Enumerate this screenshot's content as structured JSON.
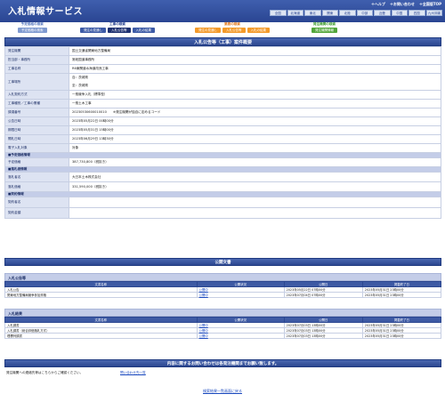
{
  "header": {
    "title": "入札情報サービス",
    "links": [
      "＋ヘルプ",
      "＋お問い合わせ",
      "＋全国版TOP"
    ],
    "regions": [
      "全国",
      "北海道",
      "東北",
      "関東",
      "北陸",
      "中部",
      "近畿",
      "中国",
      "四国",
      "九州沖縄"
    ]
  },
  "nav": {
    "groups": [
      {
        "caption": "予定価格の検索",
        "tabs": [
          "予定価格の検索"
        ]
      },
      {
        "caption": "工事の検索",
        "tabs": [
          "発注の見通し",
          "入札公告等",
          "入札の結果"
        ],
        "active": "入札公告等"
      },
      {
        "caption": "業務の検索",
        "tabs": [
          "発注の見通し",
          "入札公告等",
          "入札の結果"
        ]
      },
      {
        "caption": "発注機関の検索",
        "tabs": [
          "発注機関情報"
        ]
      }
    ]
  },
  "main": {
    "title": "入札公告等（工事）案件概要",
    "rows": [
      {
        "k": "発注機関",
        "v": "国土交通省関東地方整備局",
        "h": 10
      },
      {
        "k": "担当部・事務所",
        "v": "常総国道事務所",
        "h": 9
      },
      {
        "k": "工事名称",
        "v": "R6東関道水海道改良工事",
        "h": 9
      },
      {
        "k": "工事場所",
        "v": "自：茨城県\n至：茨城県",
        "h": 18
      },
      {
        "k": "入札契約方式",
        "v": "一般競争入札（標準型）",
        "h": 9
      },
      {
        "k": "工事種別／工事の業種",
        "v": "一般土木工事",
        "h": 9
      },
      {
        "k": "調達番号",
        "v": "20230530600010010　　※発注機関が独自に定めるコード",
        "h": 9
      },
      {
        "k": "公告日時",
        "v": "2023年05月22日 00時00分",
        "h": 9
      },
      {
        "k": "期限日時",
        "v": "2023年05月31日 15時00分",
        "h": 9
      },
      {
        "k": "開札日時",
        "v": "2023年06月29日 13時30分",
        "h": 9
      },
      {
        "k": "電子入札対象",
        "v": "対象",
        "h": 9
      },
      {
        "sec": "■予定価格情報",
        "h": 6
      },
      {
        "k": "予定価格",
        "v": "387,730,800（税抜き）",
        "h": 10
      },
      {
        "sec": "■落札者情報",
        "h": 6
      },
      {
        "k": "落札者名",
        "v": "大日本土木株式会社",
        "h": 11
      },
      {
        "k": "落札価格",
        "v": "331,590,000（税抜き）",
        "h": 11
      },
      {
        "sec": "■契約情報",
        "h": 6
      },
      {
        "k": "契約者名",
        "v": "",
        "h": 12
      },
      {
        "k": "契約金額",
        "v": "",
        "h": 12
      }
    ]
  },
  "public_docs": {
    "title": "公開文書",
    "sections": [
      {
        "name": "入札公告等",
        "headers": [
          "文書名称",
          "公開状況",
          "公開日",
          "掲載終了日"
        ],
        "rows": [
          [
            "入札公告",
            "公開中",
            "2023年05月22日 07時00分",
            "2023年05月31日 23時00分"
          ],
          [
            "関東地方整備局競争参加資格",
            "公開中",
            "2023年07月04日 07時00分",
            "2023年05月31日 23時00分"
          ]
        ]
      },
      {
        "name": "入札結果",
        "headers": [
          "文書名称",
          "公開状況",
          "公開日",
          "掲載終了日"
        ],
        "rows": [
          [
            "入札調書",
            "公開中",
            "2023年07月03日 13時00分",
            "2023年05月31日 23時00分"
          ],
          [
            "入札調書（総合評価落札方式）",
            "公開中",
            "2023年07月03日 13時00分",
            "2023年05月31日 23時00分"
          ],
          [
            "理標列調書",
            "公開中",
            "2023年07月03日 13時00分",
            "2023年05月31日 23時00分"
          ]
        ]
      }
    ]
  },
  "contact": {
    "title": "内容に関するお問い合わせは各発注機関までお願い致します。",
    "left": "発注機関への連絡先等はこちらからご確認ください。",
    "link": "問い合わせ先一覧"
  },
  "back_link": "検索結果一覧画面に戻る"
}
